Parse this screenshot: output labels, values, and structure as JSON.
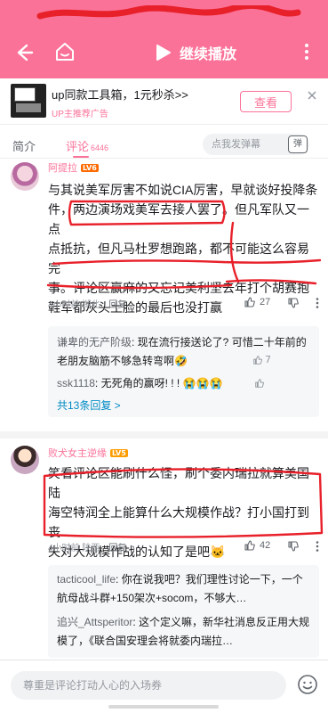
{
  "player": {
    "play_label": "继续播放"
  },
  "ad": {
    "title": "up同款工具箱，1元秒杀>>",
    "subtitle": "UP主推荐广告",
    "cta": "查看"
  },
  "tabs": {
    "intro": "简介",
    "comments": "评论",
    "comments_count": "6446",
    "danmaku_placeholder": "点我发弹幕",
    "danmaku_icon_text": "弹"
  },
  "comments": [
    {
      "user": "阿提拉",
      "level": "LV6",
      "lines": [
        "与其说美军厉害不如说CIA厉害，早就谈好投降条",
        "件，两边演场戏美军去接人罢了。但凡军队又一点",
        "点抵抗，但凡马杜罗想跑路，都不可能这么容易完",
        "事。评论区赢麻的又忘记美利坚去年打个胡赛抱",
        "鞋军都灰头土脸的最后也没打赢"
      ],
      "time": "4小时前 湖北",
      "reply": "回复",
      "likes": "27",
      "replies": [
        {
          "user": "谦卑的无产阶级",
          "text": ": 现在流行接送论了? 可惜二十年前的老朋友脑筋不够急转弯啊🤣",
          "likes": "7"
        },
        {
          "user": "ssk1118",
          "text": ": 无死角的赢呀! ! ! 😭😭😭",
          "likes": ""
        }
      ],
      "more_replies": "共13条回复 >"
    },
    {
      "user": "败犬女主逆缘",
      "level": "LV5",
      "lines": [
        "笑看评论区能刷什么怪，刷个委内瑞拉就算美国陆",
        "海空特润全上能算什么大规模作战？打小国打到丧",
        "失对大规模作战的认知了是吧🐱"
      ],
      "time": "4小时前 陕西",
      "reply": "回复",
      "likes": "42",
      "replies": [
        {
          "user": "tacticool_life",
          "text": ": 你在说我吧？我们理性讨论一下，一个航母战斗群+150架次+socom，不够大…"
        },
        {
          "user": "追兴_Attsperitor",
          "text": ": 这个定义嘛，新华社消息反正用大规模了，《联合国安理会将就委内瑞拉…"
        }
      ]
    }
  ],
  "bottom": {
    "input_placeholder": "尊重是评论打动人心的入场券"
  },
  "colors": {
    "accent": "#fb7299",
    "link": "#008ac5",
    "marker": "#e8202a"
  }
}
